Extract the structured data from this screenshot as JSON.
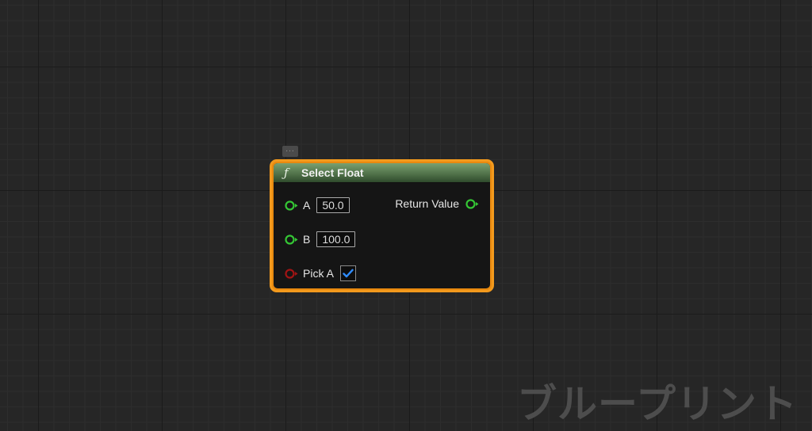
{
  "node": {
    "title": "Select Float",
    "function_icon": "ƒ",
    "comment_icon": "...",
    "header_color": "#5e8458",
    "selection_color": "#f39a1d",
    "inputs": [
      {
        "label": "A",
        "value": "50.0",
        "pin_color": "#35c635",
        "type": "float"
      },
      {
        "label": "B",
        "value": "100.0",
        "pin_color": "#35c635",
        "type": "float"
      },
      {
        "label": "Pick A",
        "checked": true,
        "pin_color": "#a11414",
        "type": "bool"
      }
    ],
    "output": {
      "label": "Return Value",
      "pin_color": "#35c635",
      "type": "float"
    }
  },
  "watermark": "ブループリント"
}
